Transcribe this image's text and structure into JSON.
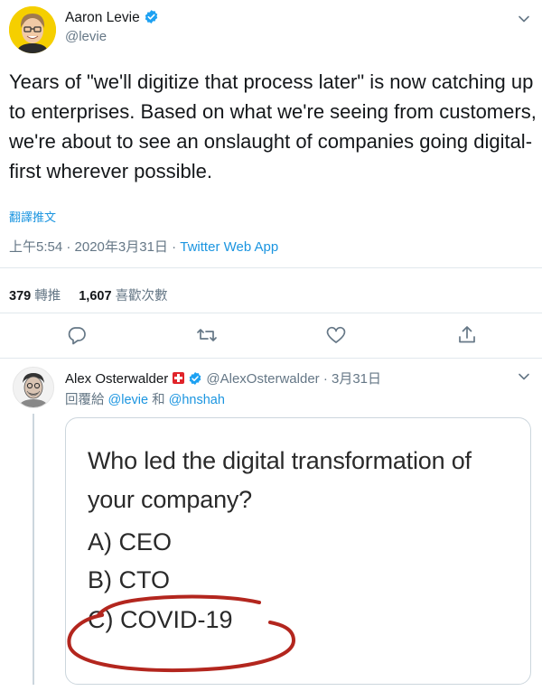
{
  "tweet": {
    "author_name": "Aaron Levie",
    "author_handle": "@levie",
    "text": "Years of \"we'll digitize that process later\" is now catching up to enterprises. Based on what we're seeing from customers, we're about to see an onslaught of companies going digital-first wherever possible.",
    "translate_label": "翻譯推文",
    "time": "上午5:54 · 2020年3月31日 · ",
    "client": "Twitter Web App",
    "retweets_count": "379",
    "retweets_label": "轉推",
    "likes_count": "1,607",
    "likes_label": "喜歡次數"
  },
  "reply": {
    "author_name": "Alex Osterwalder",
    "author_handle": "@AlexOsterwalder",
    "date": " · 3月31日",
    "reply_prefix": "回覆給 ",
    "reply_user1": "@levie",
    "reply_joiner": " 和 ",
    "reply_user2": "@hnshah",
    "image": {
      "question": "Who led the digital transformation of your company?",
      "option_a": "A) CEO",
      "option_b": "B) CTO",
      "option_c": "C) COVID-19"
    }
  },
  "colors": {
    "accent": "#1b95e0",
    "verified": "#1da1f2",
    "circle": "#b3261e"
  },
  "icons": [
    "verified-badge-icon",
    "chevron-down-icon",
    "reply-icon",
    "retweet-icon",
    "like-icon",
    "share-icon",
    "swiss-flag-icon"
  ]
}
